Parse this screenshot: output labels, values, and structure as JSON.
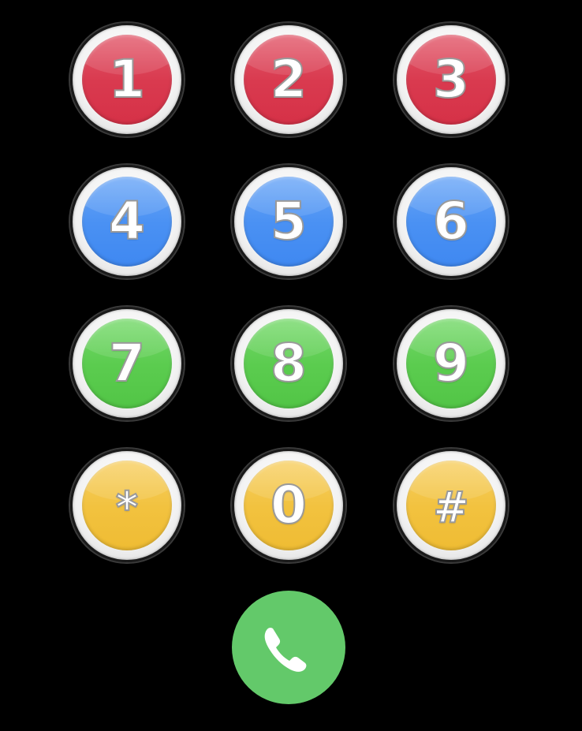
{
  "dialpad": {
    "keys": [
      {
        "label": "1",
        "color": "#d93a4f"
      },
      {
        "label": "2",
        "color": "#d93a4f"
      },
      {
        "label": "3",
        "color": "#d93a4f"
      },
      {
        "label": "4",
        "color": "#4a91f3"
      },
      {
        "label": "5",
        "color": "#4a91f3"
      },
      {
        "label": "6",
        "color": "#4a91f3"
      },
      {
        "label": "7",
        "color": "#5bcc4f"
      },
      {
        "label": "8",
        "color": "#5bcc4f"
      },
      {
        "label": "9",
        "color": "#5bcc4f"
      },
      {
        "label": "*",
        "color": "#f2c23f"
      },
      {
        "label": "0",
        "color": "#f2c23f"
      },
      {
        "label": "#",
        "color": "#f2c23f"
      }
    ]
  },
  "call": {
    "icon": "phone-icon",
    "color": "#63c96a"
  },
  "background": "#000000"
}
